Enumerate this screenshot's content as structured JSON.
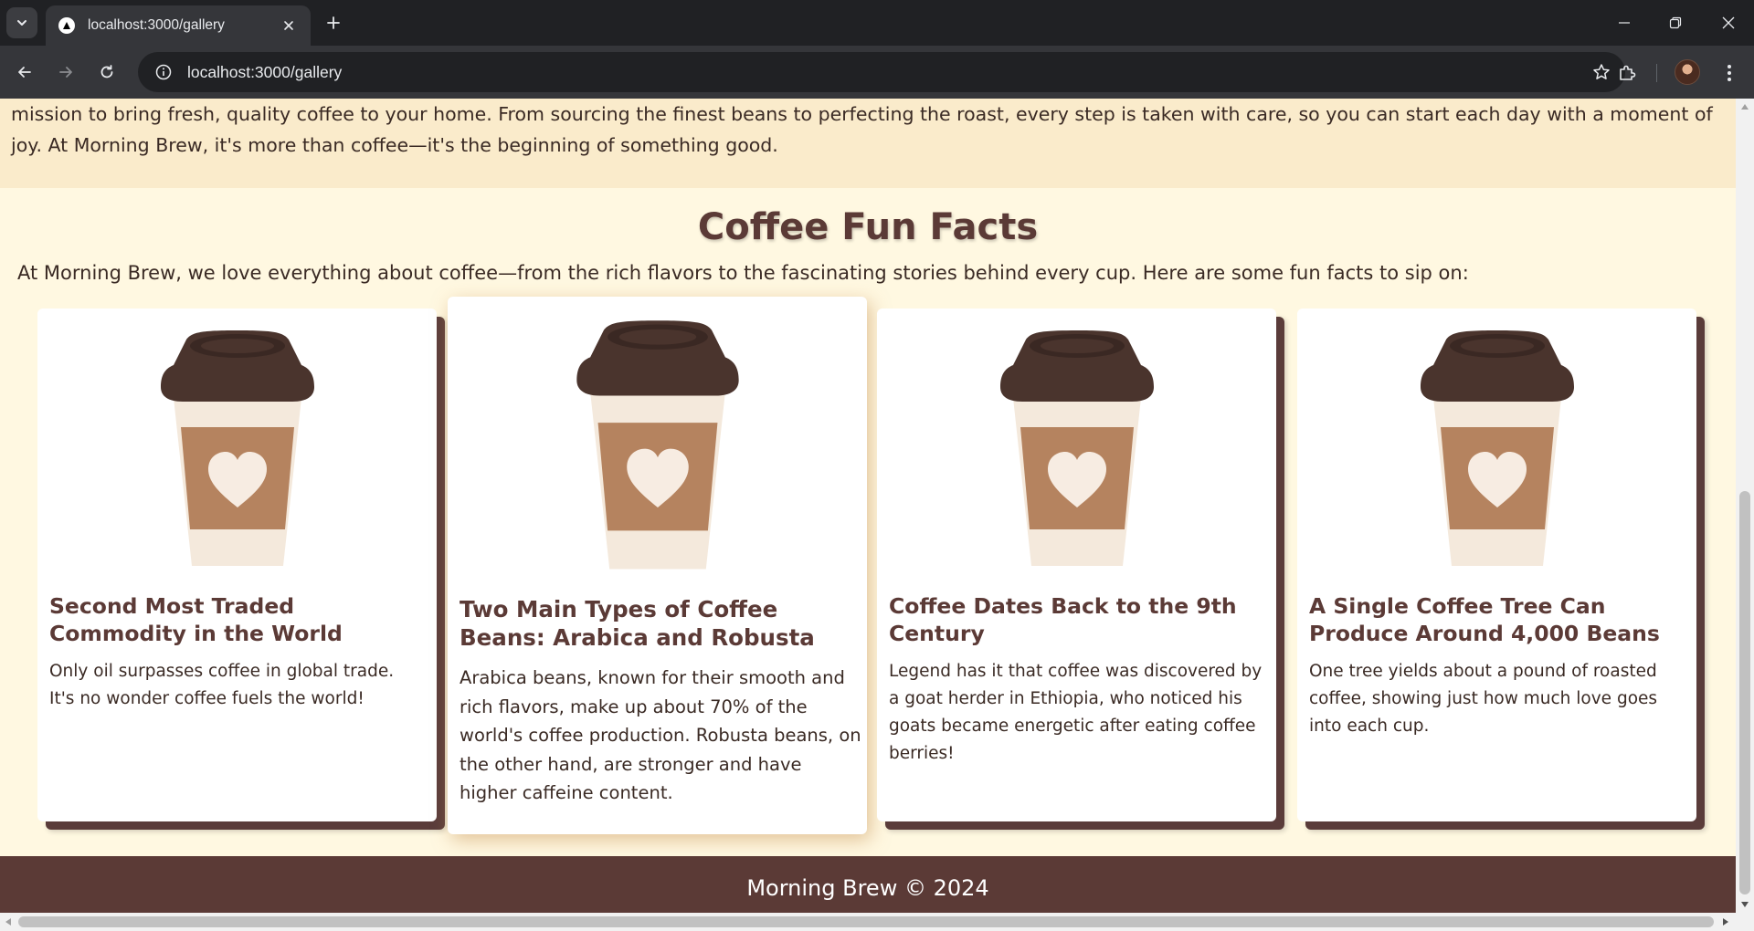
{
  "browser": {
    "tab_title": "localhost:3000/gallery",
    "url": "localhost:3000/gallery",
    "icons": {
      "tab_search": "chevron-down-icon",
      "favicon": "triangle-logo-icon",
      "tab_close": "close-icon",
      "new_tab": "plus-icon",
      "back": "arrow-left-icon",
      "forward": "arrow-right-icon",
      "reload": "reload-icon",
      "site_info": "info-icon",
      "bookmark": "star-icon",
      "extensions": "puzzle-icon",
      "profile": "avatar",
      "menu": "kebab-menu-icon"
    }
  },
  "page": {
    "about_text": "mission to bring fresh, quality coffee to your home. From sourcing the finest beans to perfecting the roast, every step is taken with care, so you can start each day with a moment of joy. At Morning Brew, it's more than coffee—it's the beginning of something good.",
    "facts_title": "Coffee Fun Facts",
    "facts_intro": "At Morning Brew, we love everything about coffee—from the rich flavors to the fascinating stories behind every cup. Here are some fun facts to sip on:",
    "cards": [
      {
        "title": "Second Most Traded Commodity in the World",
        "body": "Only oil surpasses coffee in global trade. It's no wonder coffee fuels the world!",
        "image": "coffee-cup-icon"
      },
      {
        "title": "Two Main Types of Coffee Beans: Arabica and Robusta",
        "body": "Arabica beans, known for their smooth and rich flavors, make up about 70% of the world's coffee production. Robusta beans, on the other hand, are stronger and have higher caffeine content.",
        "image": "coffee-cup-icon"
      },
      {
        "title": "Coffee Dates Back to the 9th Century",
        "body": "Legend has it that coffee was discovered by a goat herder in Ethiopia, who noticed his goats became energetic after eating coffee berries!",
        "image": "coffee-cup-icon"
      },
      {
        "title": "A Single Coffee Tree Can Produce Around 4,000 Beans",
        "body": "One tree yields about a pound of roasted coffee, showing just how much love goes into each cup.",
        "image": "coffee-cup-icon"
      }
    ],
    "footer_text": "Morning Brew © 2024"
  },
  "colors": {
    "page_bg": "#fff8e1",
    "about_band_bg": "#faebcb",
    "heading": "#5b3a36",
    "footer_bg": "#5b3a36",
    "card_shadow": "#5a3c3a"
  }
}
